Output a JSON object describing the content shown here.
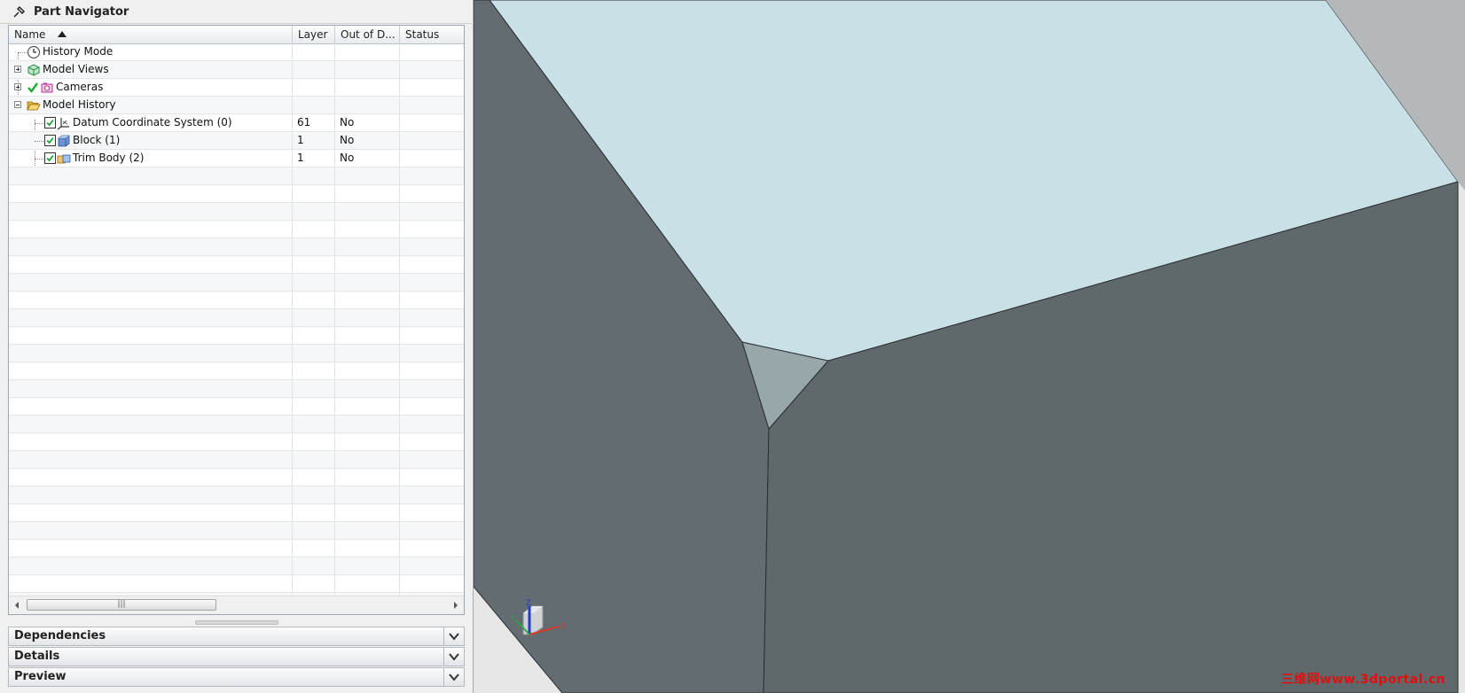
{
  "panel": {
    "title": "Part Navigator"
  },
  "columns": {
    "name": "Name",
    "layer": "Layer",
    "out_of_date": "Out of D...",
    "status": "Status"
  },
  "tree": [
    {
      "label": "History Mode",
      "layer": "",
      "ood": "",
      "expander": "none",
      "check": false,
      "icon": "history-mode-icon"
    },
    {
      "label": "Model Views",
      "layer": "",
      "ood": "",
      "expander": "plus",
      "check": false,
      "icon": "model-views-icon"
    },
    {
      "label": "Cameras",
      "layer": "",
      "ood": "",
      "expander": "plus",
      "check": true,
      "icon": "cameras-icon"
    },
    {
      "label": "Model History",
      "layer": "",
      "ood": "",
      "expander": "minus",
      "check": false,
      "icon": "folder-open-icon"
    },
    {
      "label": "Datum Coordinate System (0)",
      "layer": "61",
      "ood": "No",
      "check": true,
      "icon": "datum-csys-icon"
    },
    {
      "label": "Block (1)",
      "layer": "1",
      "ood": "No",
      "check": true,
      "icon": "block-icon"
    },
    {
      "label": "Trim Body (2)",
      "layer": "1",
      "ood": "No",
      "check": true,
      "icon": "trim-body-icon"
    }
  ],
  "scrollbar_thumb": "|||",
  "sections": {
    "dependencies": "Dependencies",
    "details": "Details",
    "preview": "Preview"
  },
  "viewport": {
    "triad_labels": {
      "x": "X",
      "y": "Y",
      "z": "Z"
    },
    "watermark": "三维网www.3dportal.cn"
  },
  "colors": {
    "top_face": "#c9e0e6",
    "left_face": "#636c70",
    "right_face": "#5f686b",
    "chamfer_face": "#98a7aa",
    "background": "#e6e6e6"
  }
}
